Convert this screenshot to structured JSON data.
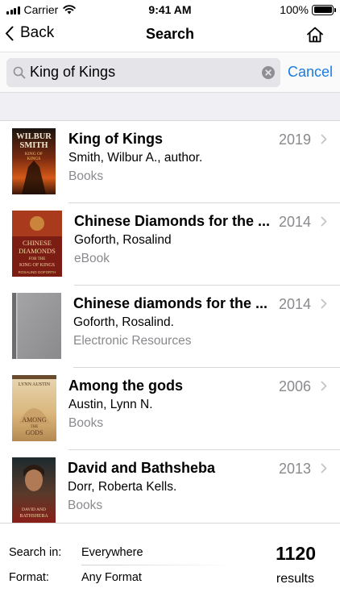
{
  "status_bar": {
    "carrier": "Carrier",
    "time": "9:41 AM",
    "battery": "100%"
  },
  "nav": {
    "back_label": "Back",
    "title": "Search",
    "home_icon": "home-icon"
  },
  "search": {
    "query": "King of Kings",
    "cancel_label": "Cancel"
  },
  "results": [
    {
      "title": "King of Kings",
      "author": "Smith, Wilbur A., author.",
      "format": "Books",
      "year": "2019"
    },
    {
      "title": "Chinese Diamonds for the ...",
      "author": "Goforth, Rosalind",
      "format": "eBook",
      "year": "2014"
    },
    {
      "title": "Chinese diamonds for the ...",
      "author": "Goforth, Rosalind.",
      "format": "Electronic Resources",
      "year": "2014"
    },
    {
      "title": "Among the gods",
      "author": "Austin, Lynn N.",
      "format": "Books",
      "year": "2006"
    },
    {
      "title": "David and Bathsheba",
      "author": "Dorr, Roberta Kells.",
      "format": "Books",
      "year": "2013"
    }
  ],
  "covers": {
    "cover1": {
      "line1": "WILBUR",
      "line2": "SMITH",
      "line3": "KING OF",
      "line4": "KINGS"
    },
    "cover2": {
      "line1": "CHINESE",
      "line2": "DIAMONDS",
      "line3": "FOR THE",
      "line4": "KING OF KINGS",
      "line5": "ROSALIND GOFORTH"
    },
    "cover4": {
      "line1": "LYNN AUSTIN",
      "line2": "AMONG",
      "line3": "THE",
      "line4": "GODS"
    },
    "cover5": {
      "line1": "DAVID AND",
      "line2": "BATHSHEBA"
    }
  },
  "filters": {
    "search_in_label": "Search in:",
    "search_in_value": "Everywhere",
    "format_label": "Format:",
    "format_value": "Any Format"
  },
  "summary": {
    "count": "1120",
    "count_label": "results"
  },
  "colors": {
    "accent": "#1a7ce1",
    "secondary_text": "#8a8a8e",
    "band": "#efeff4"
  }
}
